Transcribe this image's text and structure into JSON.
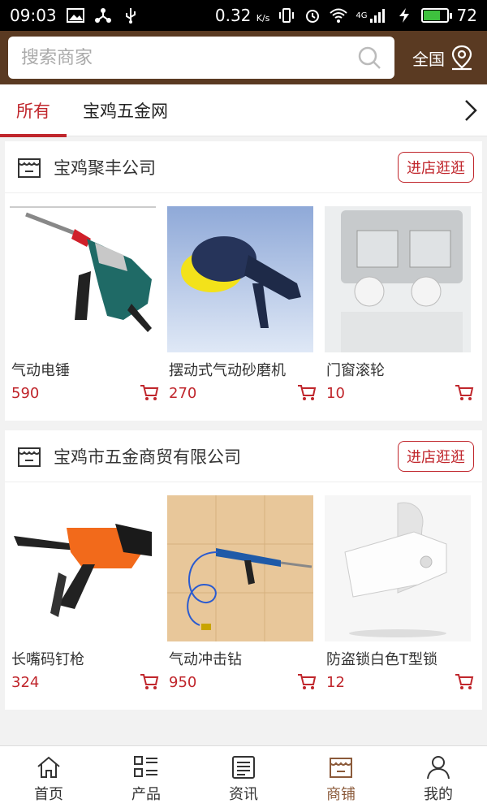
{
  "status_bar": {
    "time": "09:03",
    "speed": "0.32",
    "speed_unit": "K/s",
    "network": "4G",
    "battery": "72",
    "battery_level": 0.72
  },
  "header": {
    "search_placeholder": "搜索商家",
    "region_label": "全国"
  },
  "tabs": [
    {
      "label": "所有",
      "active": true
    },
    {
      "label": "宝鸡五金网",
      "active": false
    }
  ],
  "shops": [
    {
      "name": "宝鸡聚丰公司",
      "visit_label": "进店逛逛",
      "products": [
        {
          "name": "气动电锤",
          "price": "590"
        },
        {
          "name": "摆动式气动砂磨机",
          "price": "270"
        },
        {
          "name": "门窗滚轮",
          "price": "10"
        }
      ]
    },
    {
      "name": "宝鸡市五金商贸有限公司",
      "visit_label": "进店逛逛",
      "products": [
        {
          "name": "长嘴码钉枪",
          "price": "324"
        },
        {
          "name": "气动冲击钻",
          "price": "950"
        },
        {
          "name": "防盗锁白色T型锁",
          "price": "12"
        }
      ]
    }
  ],
  "bottom_nav": [
    {
      "label": "首页",
      "icon": "home-icon",
      "active": false
    },
    {
      "label": "产品",
      "icon": "grid-list-icon",
      "active": false
    },
    {
      "label": "资讯",
      "icon": "news-icon",
      "active": false
    },
    {
      "label": "商铺",
      "icon": "shop-icon",
      "active": true
    },
    {
      "label": "我的",
      "icon": "user-icon",
      "active": false
    }
  ],
  "colors": {
    "header_bg": "#5a3a22",
    "accent_red": "#c0262c",
    "nav_active": "#8b5a3a",
    "battery_green": "#3ec13e"
  }
}
